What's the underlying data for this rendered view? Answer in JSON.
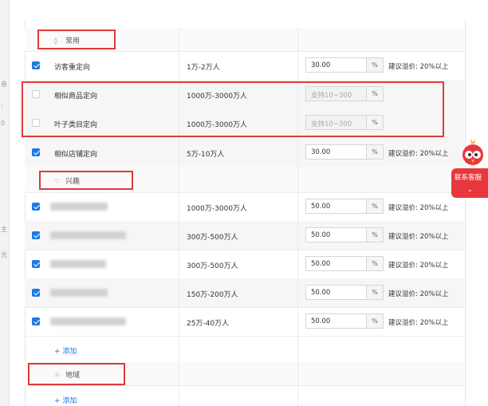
{
  "sections": {
    "common": {
      "icon": "leaf-icon",
      "label": "常用"
    },
    "interest": {
      "icon": "heart-icon",
      "label": "兴趣"
    },
    "region": {
      "icon": "globe-icon",
      "label": "地域"
    }
  },
  "common_rows": [
    {
      "checked": true,
      "name": "访客重定向",
      "size": "1万-2万人",
      "bid": "30.00",
      "unit": "%",
      "tip": "建议溢价: 20%以上"
    },
    {
      "checked": false,
      "name": "相似商品定向",
      "size": "1000万-3000万人",
      "bid": "支持10~300",
      "unit": "%",
      "tip": ""
    },
    {
      "checked": false,
      "name": "叶子类目定向",
      "size": "1000万-3000万人",
      "bid": "支持10~300",
      "unit": "%",
      "tip": ""
    },
    {
      "checked": true,
      "name": "相似店铺定向",
      "size": "5万-10万人",
      "bid": "30.00",
      "unit": "%",
      "tip": "建议溢价: 20%以上"
    }
  ],
  "interest_rows": [
    {
      "checked": true,
      "size": "1000万-3000万人",
      "bid": "50.00",
      "unit": "%",
      "tip": "建议溢价: 20%以上"
    },
    {
      "checked": true,
      "size": "300万-500万人",
      "bid": "50.00",
      "unit": "%",
      "tip": "建议溢价: 20%以上"
    },
    {
      "checked": true,
      "size": "300万-500万人",
      "bid": "50.00",
      "unit": "%",
      "tip": "建议溢价: 20%以上"
    },
    {
      "checked": true,
      "size": "150万-200万人",
      "bid": "50.00",
      "unit": "%",
      "tip": "建议溢价: 20%以上"
    },
    {
      "checked": true,
      "size": "25万-40万人",
      "bid": "50.00",
      "unit": "%",
      "tip": "建议溢价: 20%以上"
    }
  ],
  "add_label": "+ 添加",
  "customer_service": {
    "label": "联系客服",
    "icon": "chevron-down-icon",
    "mascot": "bird-mascot-icon"
  },
  "colors": {
    "accent": "#1d7ae3",
    "highlight": "#e03a3a",
    "service": "#e8383d"
  }
}
